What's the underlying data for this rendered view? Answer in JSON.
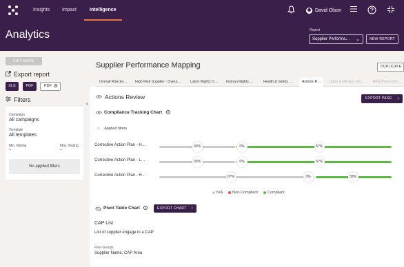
{
  "nav": {
    "links": [
      "Insights",
      "Impact",
      "Intelligence"
    ],
    "active": "Intelligence",
    "user_name": "David Olson",
    "icons": [
      "bell-icon",
      "menu-icon",
      "help-icon",
      "grid-icon"
    ],
    "accent_color": "#e8743b",
    "brand_color": "#3a1f4a"
  },
  "header": {
    "title": "Analytics",
    "report_label": "Report",
    "report_value": "Supplier Performa…",
    "new_report": "NEW REPORT"
  },
  "sidebar": {
    "edit_mode": "EDIT MODE",
    "export_title": "Export report",
    "export_buttons": [
      "XLS",
      "PDF",
      "PDF"
    ],
    "filters_title": "Filters",
    "campaign_label": "Campaign",
    "campaign_value": "All campaigns",
    "template_label": "Template",
    "template_value": "All templates",
    "min_rating_label": "Min. Rating",
    "min_rating_value": "–",
    "max_rating_label": "Max. Rating",
    "max_rating_value": "–",
    "no_filters": "No applied filters"
  },
  "main": {
    "title": "Supplier Performance Mapping",
    "duplicate": "DUPLICATE",
    "tabs": [
      {
        "label": "Overall Risk Ev…",
        "state": "normal"
      },
      {
        "label": "High Risk Supplier - Overa…",
        "state": "normal"
      },
      {
        "label": "Labor Rights O…",
        "state": "normal"
      },
      {
        "label": "Human Rights …",
        "state": "normal"
      },
      {
        "label": "Health & Safety …",
        "state": "normal"
      },
      {
        "label": "Actions R…",
        "state": "active"
      },
      {
        "label": "Labor & Modern Sla…",
        "state": "dim"
      },
      {
        "label": "RFQ Price Com…",
        "state": "dim"
      }
    ],
    "section_title": "Actions Review",
    "export_page": "EXPORT PAGE",
    "chart_title": "Compliance Tracking Chart",
    "applied_filters": "Applied filters",
    "pivot_title": "Pivot Table Chart",
    "export_chart": "EXPORT CHART",
    "cap_list": "CAP List",
    "cap_desc": "List of supplier engage in a CAP",
    "row_groups_label": "Row Groups",
    "row_groups_value": "Supplier Name, CAP Area"
  },
  "chart_data": {
    "type": "bar",
    "orientation": "horizontal-stacked",
    "categories": [
      "Corrective Action Plan - H…",
      "Corrective Action Plan - L…",
      "Corrective Action Plan - H…"
    ],
    "series": [
      {
        "name": "N/A",
        "color": "#c9c9c9",
        "values": [
          33,
          33,
          67
        ]
      },
      {
        "name": "Non-Compliant",
        "color": "#e0533d",
        "values": [
          0,
          0,
          0
        ]
      },
      {
        "name": "Compliant",
        "color": "#5fb846",
        "values": [
          67,
          67,
          33
        ]
      }
    ],
    "labels": [
      [
        "33%",
        "0%",
        "67%"
      ],
      [
        "33%",
        "0%",
        "67%"
      ],
      [
        "67%",
        "0%",
        "33%"
      ]
    ],
    "legend_position": "bottom"
  }
}
